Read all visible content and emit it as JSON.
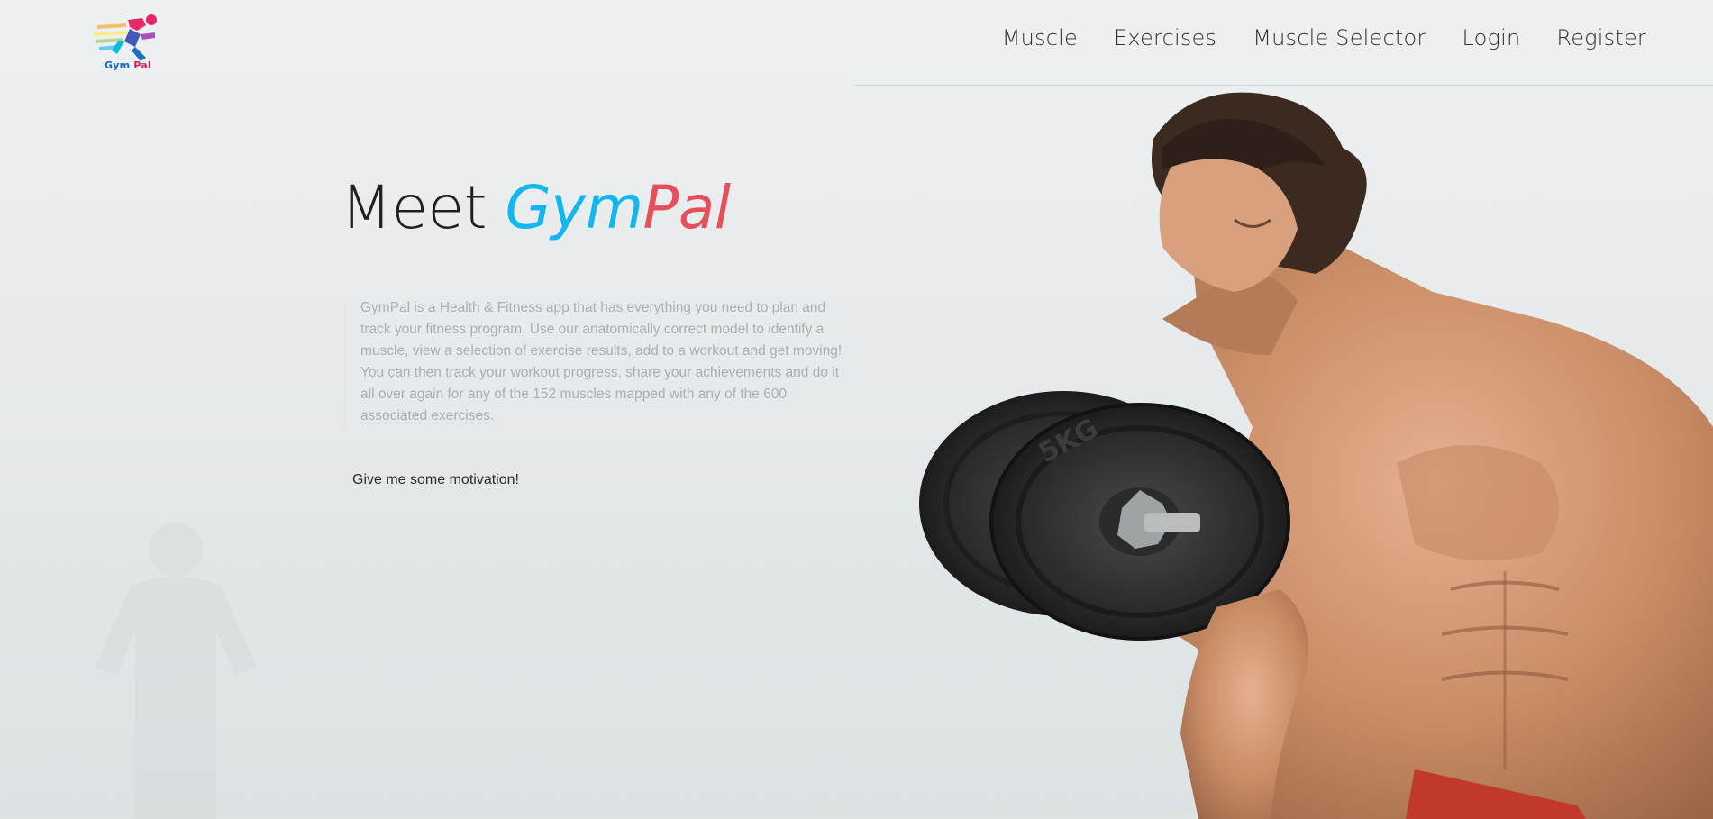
{
  "brand": {
    "logo_text_1": "Gym",
    "logo_text_2": "Pal"
  },
  "nav": {
    "items": [
      {
        "label": "Muscle"
      },
      {
        "label": "Exercises"
      },
      {
        "label": "Muscle Selector"
      },
      {
        "label": "Login"
      },
      {
        "label": "Register"
      }
    ]
  },
  "hero": {
    "title_prefix": "Meet",
    "title_brand_1": "Gym",
    "title_brand_2": "Pal",
    "description": "GymPal is a Health & Fitness app that has everything you need to plan and track your fitness program. Use our anatomically correct model to identify a muscle, view a selection of exercise results, add to a workout and get moving! You can then track your workout progress, share your achievements and do it all over again for any of the 152 muscles mapped with any of the 600 associated exercises.",
    "cta_label": "Give me some motivation!",
    "dumbbell_text": "5KG"
  },
  "colors": {
    "brand_blue": "#13b6ef",
    "brand_red": "#e5505a",
    "text_muted": "#a9afb3"
  }
}
